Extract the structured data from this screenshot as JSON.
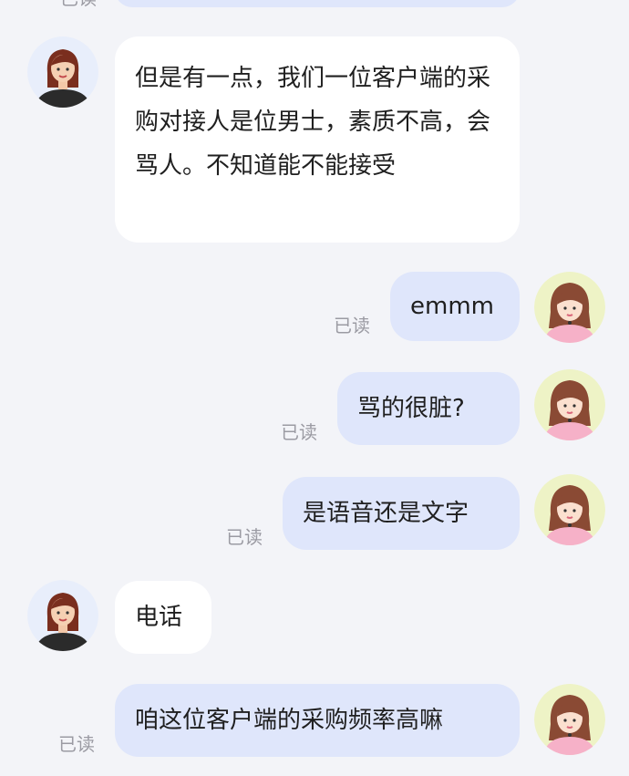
{
  "chat": {
    "top_read": "已读",
    "messages": [
      {
        "from": "other",
        "text": "但是有一点，我们一位客户端的采购对接人是位男士，素质不高，会骂人。不知道能不能接受"
      },
      {
        "from": "me",
        "text": "emmm",
        "status": "已读"
      },
      {
        "from": "me",
        "text": "骂的很脏?",
        "status": "已读"
      },
      {
        "from": "me",
        "text": "是语音还是文字",
        "status": "已读"
      },
      {
        "from": "other",
        "text": "电话"
      },
      {
        "from": "me",
        "text": "咱这位客户端的采购频率高嘛",
        "status": "已读"
      }
    ]
  },
  "colors": {
    "background": "#f3f4f8",
    "incoming_bubble": "#ffffff",
    "outgoing_bubble": "#dfe6fb",
    "read_status": "#9b9ba3"
  },
  "icons": {
    "other_avatar": "woman-dark-hair-avatar-icon",
    "my_avatar": "girl-avatar-icon"
  }
}
